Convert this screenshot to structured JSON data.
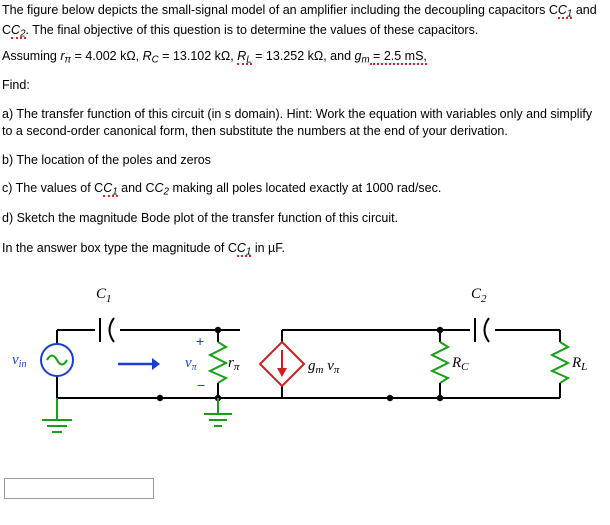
{
  "question": {
    "intro_line1": "The figure below depicts the small-signal model of an amplifier including the decoupling capacitors C",
    "intro_sub1": "1",
    "intro_line1b": "and C",
    "intro_sub2": "2",
    "intro_line1c": ". The final objective of this question is to determine the values of these capacitors.",
    "assuming_prefix": "Assuming ",
    "assuming_rpi": "r",
    "assuming_rpi_sub": "π",
    "assuming_rpi_val": " = 4.002 kΩ, ",
    "assuming_rc": "R",
    "assuming_rc_sub": "C",
    "assuming_rc_val": " = 13.102 kΩ, ",
    "assuming_rl": "R",
    "assuming_rl_sub": "L",
    "assuming_rl_val": " = 13.252 kΩ, and ",
    "assuming_gm": "g",
    "assuming_gm_sub": "m",
    "assuming_gm_val": " = 2.5 mS,",
    "find": "Find:",
    "item_a": "a) The transfer function of this circuit (in s domain). Hint: Work the equation with variables only and simplify to a second-order canonical form, then substitute the numbers at the end of your derivation.",
    "item_b": "b) The location of the poles and zeros",
    "item_c_1": "c) The values of C",
    "item_c_sub1": "1",
    "item_c_2": " and C",
    "item_c_sub2": "2",
    "item_c_3": " making all poles located exactly at 1000 rad/sec.",
    "item_d": "d) Sketch the magnitude Bode plot of the transfer function of this circuit.",
    "answer_instruction_1": "In the answer box type the magnitude of C",
    "answer_instruction_sub": "1",
    "answer_instruction_2": " in µF."
  },
  "circuit": {
    "labels": {
      "c1": "C",
      "c1_sub": "1",
      "c2": "C",
      "c2_sub": "2",
      "vin": "v",
      "vin_sub": "in",
      "vpi": "v",
      "vpi_sub": "π",
      "rpi": "r",
      "rpi_sub": "π",
      "gm_vpi_g": "g",
      "gm_vpi_m": "m",
      "gm_vpi_v": "v",
      "gm_vpi_pi": "π",
      "rc": "R",
      "rc_sub": "C",
      "rl": "R",
      "rl_sub": "L",
      "plus": "+",
      "minus": "−"
    },
    "colors": {
      "wire": "#000000",
      "source_blue": "#1a3fd0",
      "source_green": "#15a015",
      "resistor_blue": "#1a3fd0",
      "resistor_green": "#15a015",
      "arrow_blue": "#1a3fd0",
      "ground_green": "#15a015",
      "cap_black": "#000000",
      "dep_source_red": "#cc2020"
    }
  },
  "answer_box": {
    "value": "",
    "placeholder": ""
  }
}
